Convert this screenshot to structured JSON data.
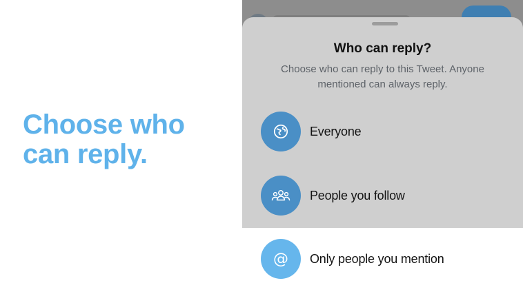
{
  "promo": {
    "headline_line1": "Choose who",
    "headline_line2": "can reply."
  },
  "sheet": {
    "title": "Who can reply?",
    "description": "Choose who can reply to this Tweet. Anyone mentioned can always reply.",
    "options": [
      {
        "label": "Everyone",
        "icon": "globe-icon"
      },
      {
        "label": "People you follow",
        "icon": "people-icon"
      },
      {
        "label": "Only people you mention",
        "icon": "at-sign-icon"
      }
    ]
  },
  "colors": {
    "headline": "#5fb2ea",
    "option_icon_dimmed": "#4a8fc6",
    "option_icon": "#66b6ec",
    "sheet_dimmed": "#cfcfcf"
  }
}
